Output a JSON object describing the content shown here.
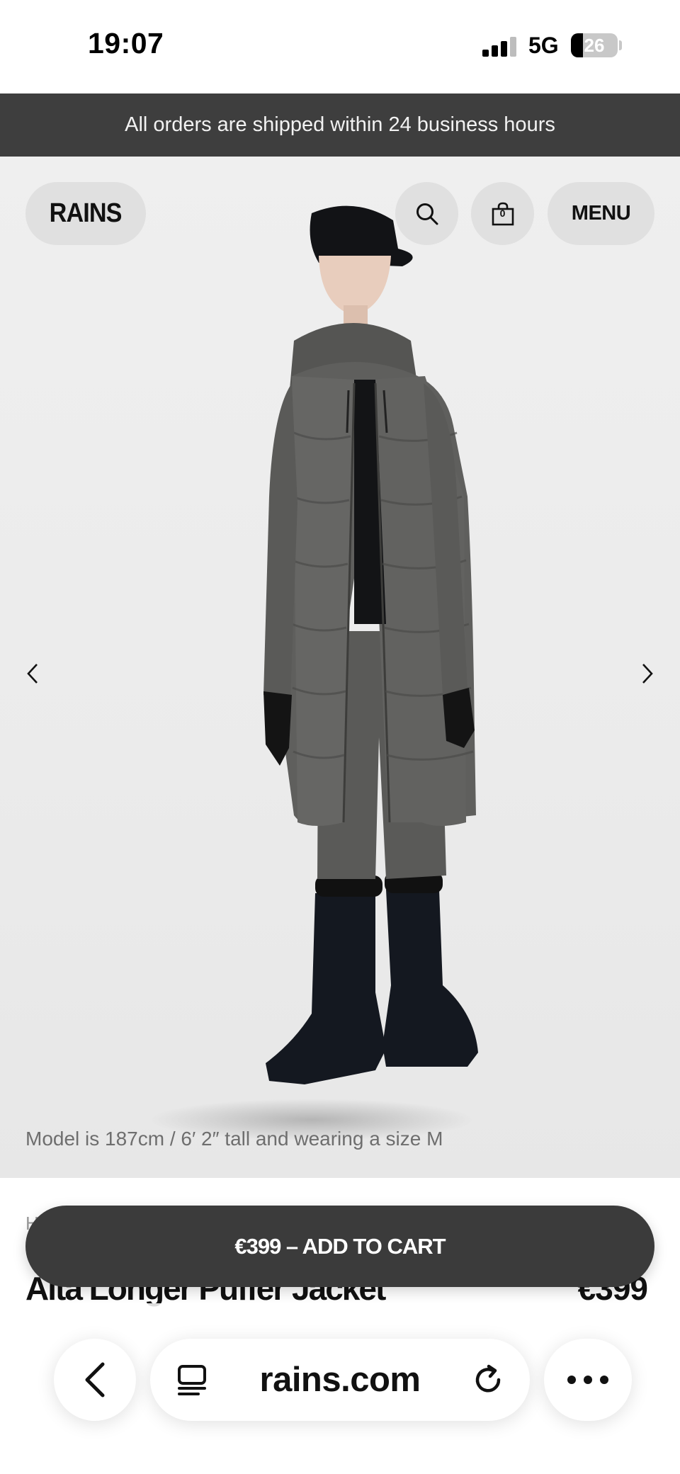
{
  "status_bar": {
    "time": "19:07",
    "network": "5G",
    "battery": "26"
  },
  "announcement": "All orders are shipped within 24 business hours",
  "header": {
    "logo": "RAINS",
    "cart_count": "0",
    "menu_label": "MENU"
  },
  "hero": {
    "model_note": "Model is 187cm / 6′ 2″ tall and wearing a size M"
  },
  "product": {
    "breadcrumb_hint": "H",
    "title": "Alta Longer Puffer Jacket",
    "price": "€399"
  },
  "cart_button": "€399 – ADD TO CART",
  "browser": {
    "url": "rains.com"
  },
  "colors": {
    "announcement_bg": "#3e3e3e",
    "cart_button_bg": "#3b3b3b",
    "jacket": "#5f5f5d"
  }
}
